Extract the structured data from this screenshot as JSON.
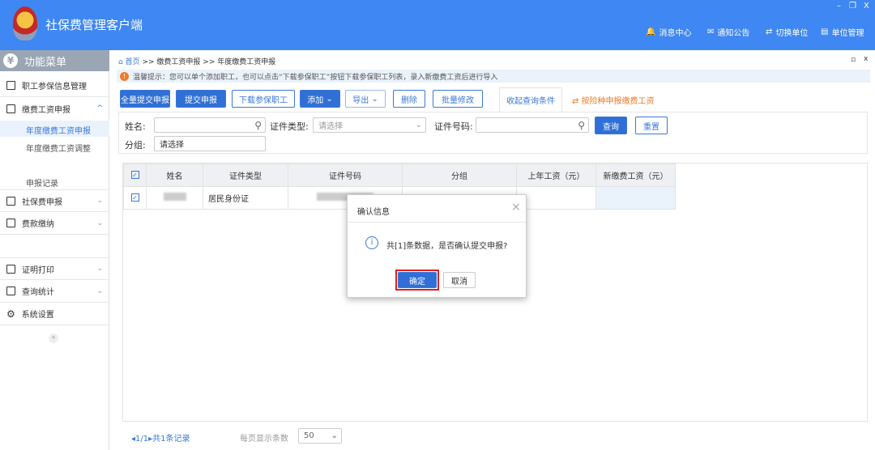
{
  "app": {
    "title": "社保费管理客户端",
    "nav": [
      {
        "icon": "message-icon",
        "label": "消息中心"
      },
      {
        "icon": "notice-icon",
        "label": "通知公告"
      },
      {
        "icon": "switch-icon",
        "label": "切换单位"
      },
      {
        "icon": "unit-icon",
        "label": "单位管理"
      }
    ],
    "window": {
      "minimize": "–",
      "restore": "❐",
      "close": "X"
    }
  },
  "sidebar": {
    "title": "功能菜单",
    "items": [
      {
        "label": "职工参保信息管理"
      },
      {
        "label": "缴费工资申报",
        "expanded": true,
        "children": [
          "年度缴费工资申报",
          "年度缴费工资调整",
          "申报记录"
        ]
      },
      {
        "label": "社保费申报"
      },
      {
        "label": "费款缴纳"
      },
      {
        "label": "证明打印"
      },
      {
        "label": "查询统计"
      },
      {
        "label": "系统设置"
      }
    ],
    "collapse": "«"
  },
  "breadcrumb": {
    "home": "首页",
    "path": ">> 缴费工资申报 >> 年度缴费工资申报"
  },
  "tip": "温馨提示：您可以单个添加职工，也可以点击“下载参保职工”按钮下载参保职工列表，录入新缴费工资后进行导入",
  "toolbar": {
    "submit_all": "全量提交申报",
    "submit": "提交申报",
    "download": "下载参保职工",
    "add": "添加",
    "export": "导出",
    "delete": "删除",
    "batch_edit": "批量修改",
    "collapse_query": "收起查询条件",
    "by_insurance": "按险种申报缴费工资"
  },
  "search": {
    "name_label": "姓名:",
    "id_type_label": "证件类型:",
    "id_type_placeholder": "请选择",
    "id_no_label": "证件号码:",
    "group_label": "分组:",
    "group_value": "请选择",
    "query": "查询",
    "reset": "重置"
  },
  "table": {
    "columns": [
      "姓名",
      "证件类型",
      "证件号码",
      "分组",
      "上年工资（元）",
      "新缴费工资（元）"
    ],
    "rows": [
      {
        "checked": true,
        "id_type": "居民身份证"
      }
    ]
  },
  "pagination": {
    "page": "1/1",
    "total": "共1条记录",
    "page_size_label": "每页显示条数",
    "page_size": "50"
  },
  "dialog": {
    "title": "确认信息",
    "message": "共[1]条数据，是否确认提交申报?",
    "ok": "确定",
    "cancel": "取消",
    "close": "×"
  },
  "colors": {
    "primary": "#2f6fd6",
    "topbar": "#3f87f2",
    "highlight": "#e02020",
    "orange": "#f07a2a"
  }
}
